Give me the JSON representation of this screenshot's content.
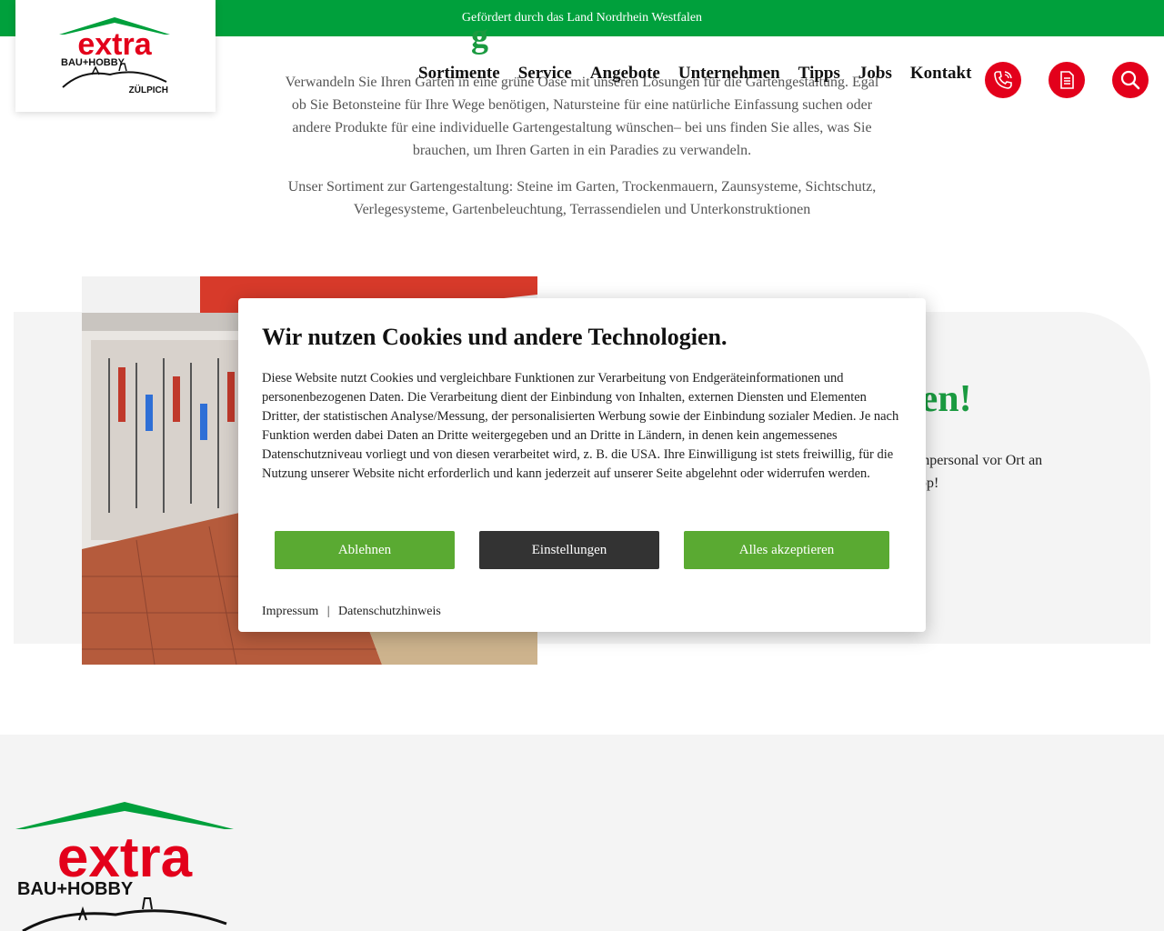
{
  "topbar": {
    "text": "Gefördert durch das Land Nordrhein Westfalen"
  },
  "logo": {
    "brand": "extra",
    "sub": "BAU+HOBBY",
    "location": "ZÜLPICH"
  },
  "nav": {
    "items": [
      "Sortimente",
      "Service",
      "Angebote",
      "Unternehmen",
      "Tipps",
      "Jobs",
      "Kontakt"
    ]
  },
  "header_icons": [
    "phone-icon",
    "document-icon",
    "search-icon"
  ],
  "colors": {
    "green": "#00a03c",
    "red": "#e3001b",
    "button_green": "#5aaa32",
    "button_dark": "#333333"
  },
  "intro": {
    "heading_fragment": "g",
    "paragraph1": "Verwandeln Sie Ihren Garten in eine grüne Oase mit unseren Lösungen für die Gartengestaltung. Egal ob Sie Betonsteine für Ihre Wege benötigen, Natursteine für eine natürliche Einfassung suchen oder andere Produkte für eine individuelle Gartengestaltung wünschen– bei uns finden Sie alles, was Sie brauchen, um Ihren Garten in ein Paradies zu verwandeln.",
    "paragraph2": "Unser Sortiment zur Gartengestaltung: Steine im Garten, Trockenmauern, Zaunsysteme, Sichtschutz, Verlegesysteme, Gartenbeleuchtung, Terrassendielen und Unterkonstruktionen"
  },
  "promo": {
    "heading_fragment": "rten!",
    "text_line1": "achpersonal vor Ort an",
    "text_line2": "pp!"
  },
  "cookie": {
    "title": "Wir nutzen Cookies und andere Technologien.",
    "body": "Diese Website nutzt Cookies und vergleichbare Funktionen zur Verarbeitung von Endgeräteinformationen und personenbezogenen Daten. Die Verarbeitung dient der Einbindung von Inhalten, externen Diensten und Elementen Dritter, der statistischen Analyse/Messung, der personalisierten Werbung sowie der Einbindung sozialer Medien. Je nach Funktion werden dabei Daten an Dritte weitergegeben und an Dritte in Ländern, in denen kein angemessenes Datenschutzniveau vorliegt und von diesen verarbeitet wird, z. B. die USA. Ihre Einwilligung ist stets freiwillig, für die Nutzung unserer Website nicht erforderlich und kann jederzeit auf unserer Seite abgelehnt oder widerrufen werden.",
    "decline": "Ablehnen",
    "settings": "Einstellungen",
    "accept": "Alles akzeptieren",
    "link_imprint": "Impressum",
    "separator": "|",
    "link_privacy": "Datenschutzhinweis"
  }
}
